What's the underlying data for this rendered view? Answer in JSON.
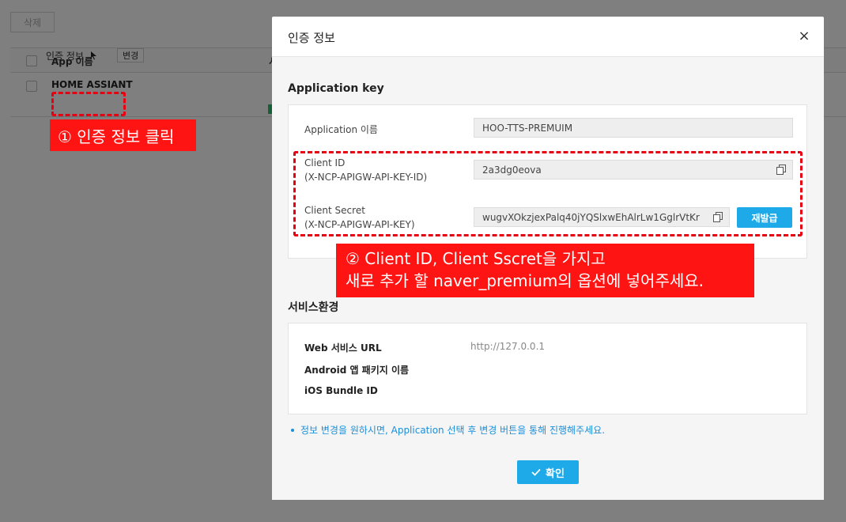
{
  "background": {
    "delete_label": "삭제",
    "col_app": "App 이름",
    "col_s": "서",
    "app_name": "HOME ASSIANT",
    "auth_info_label": "인증 정보",
    "change_label": "변경"
  },
  "annotations": {
    "step1": "① 인증 정보 클릭",
    "step2_line1": "② Client ID, Client Sscret을 가지고",
    "step2_line2": "새로 추가 할 naver_premium의 옵션에 넣어주세요."
  },
  "modal": {
    "title": "인증 정보",
    "close": "×",
    "app_key_section": "Application key",
    "app_name_label": "Application 이름",
    "app_name_value": "HOO-TTS-PREMUIM",
    "client_id_label_1": "Client ID",
    "client_id_label_2": "(X-NCP-APIGW-API-KEY-ID)",
    "client_id_value": "2a3dg0eova",
    "client_secret_label_1": "Client Secret",
    "client_secret_label_2": "(X-NCP-APIGW-API-KEY)",
    "client_secret_value": "wugvXOkzjexPalq40jYQSlxwEhAlrLw1GglrVtKr",
    "reissue_label": "재발급",
    "service_section": "서비스환경",
    "web_url_label": "Web 서비스 URL",
    "web_url_value": "http://127.0.0.1",
    "android_label": "Android 앱 패키지 이름",
    "ios_label": "iOS Bundle ID",
    "note": "정보 변경을 원하시면, Application 선택 후 변경 버튼을 통해 진행해주세요.",
    "ok_label": "확인"
  },
  "colors": {
    "accent": "#1ea9e9",
    "annotation_red": "#ff1414",
    "note_blue": "#1a8fd8"
  }
}
